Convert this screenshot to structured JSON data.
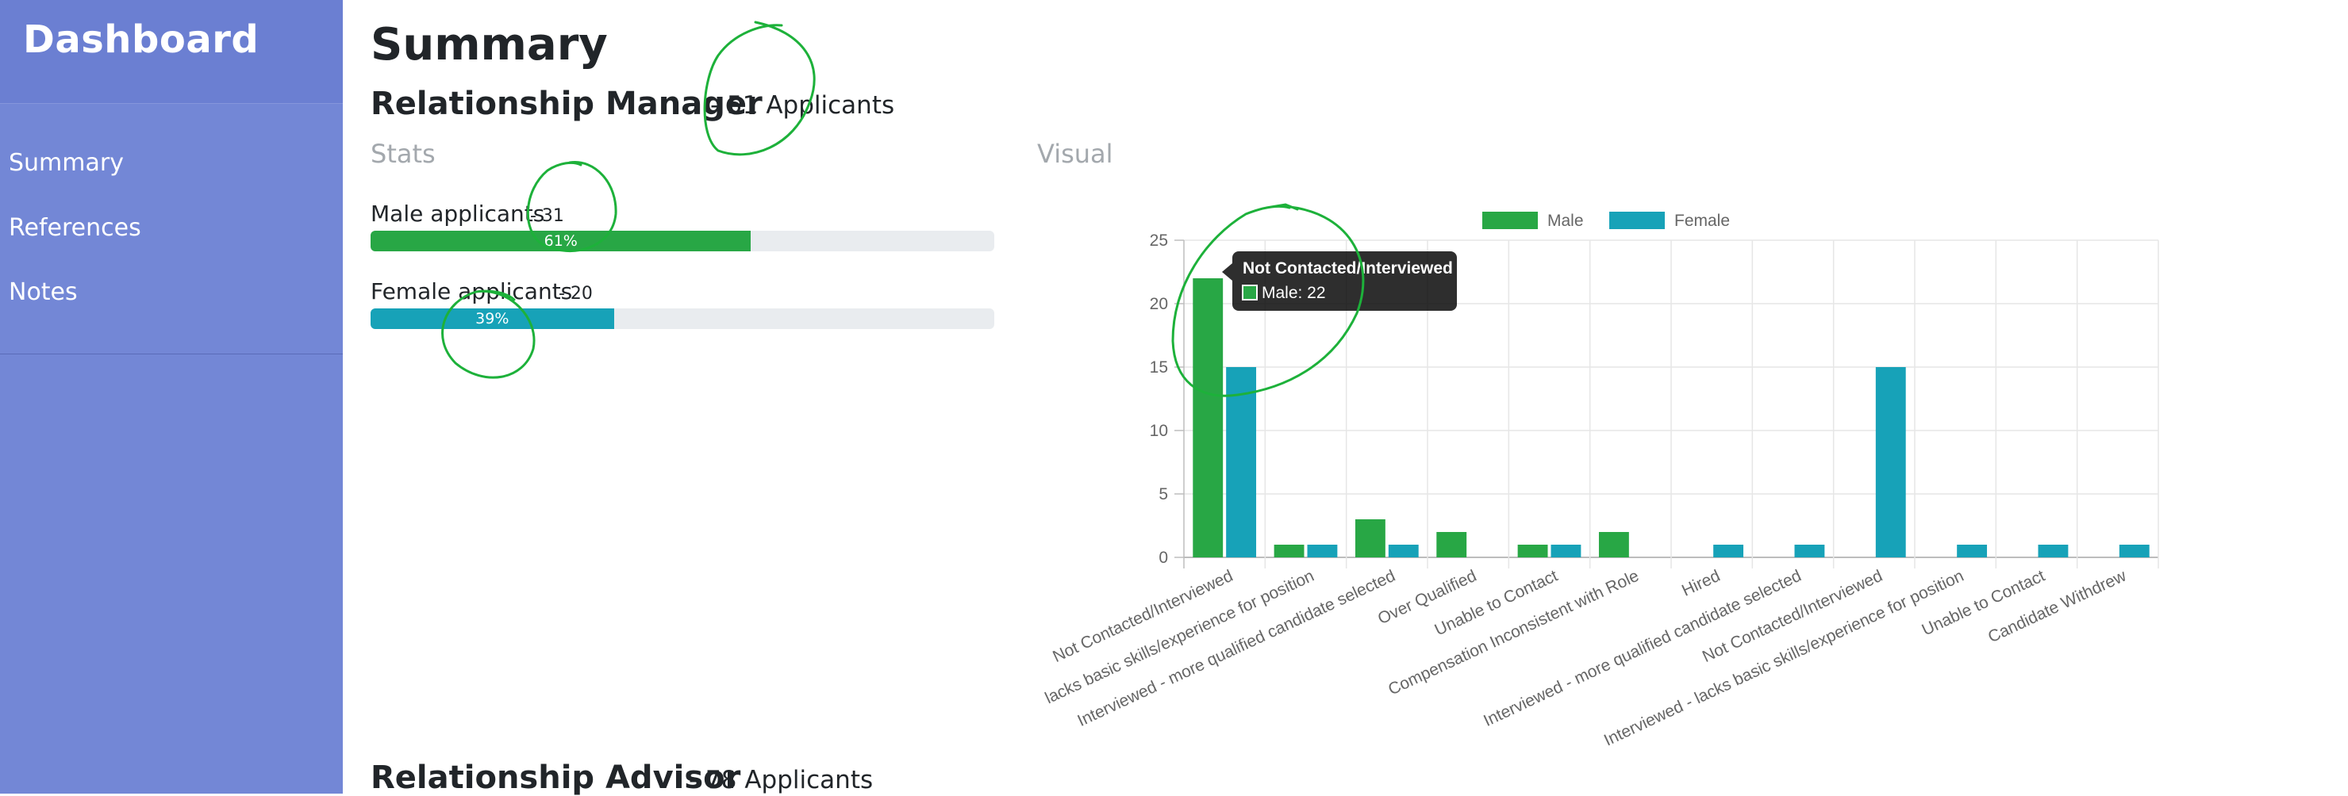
{
  "sidebar": {
    "brand": "Dashboard",
    "items": [
      {
        "label": "Summary"
      },
      {
        "label": "References"
      },
      {
        "label": "Notes"
      }
    ]
  },
  "page": {
    "title": "Summary"
  },
  "sections": [
    {
      "title": "Relationship Manager",
      "applicants": "- 51 Applicants",
      "stats_heading": "Stats",
      "visual_heading": "Visual",
      "stats": [
        {
          "label": "Male applicants",
          "count": "- 31",
          "percent_label": "61%",
          "percent": 61,
          "color": "#28a745"
        },
        {
          "label": "Female applicants",
          "count": "- 20",
          "percent_label": "39%",
          "percent": 39,
          "color": "#17a2b8"
        }
      ]
    },
    {
      "title": "Relationship Advisor",
      "applicants": "- 78 Applicants"
    }
  ],
  "tooltip": {
    "title": "Not Contacted/Interviewed",
    "body": "Male: 22"
  },
  "colors": {
    "male": "#28a745",
    "female": "#17a2b8",
    "sidebar": "#7387d6",
    "annotation": "#1db13a"
  },
  "chart_data": {
    "type": "bar",
    "legend_position": "top",
    "grid": true,
    "ylim": [
      0,
      25
    ],
    "yticks": [
      0,
      5,
      10,
      15,
      20,
      25
    ],
    "categories": [
      "Not Contacted/Interviewed",
      "lacks basic skills/experience for position",
      "Interviewed - more qualified candidate selected",
      "Over Qualified",
      "Unable to Contact",
      "Compensation Inconsistent with Role",
      "Hired",
      "Interviewed - more qualified candidate selected",
      "Not Contacted/Interviewed",
      "Interviewed - lacks basic skills/experience for position",
      "Unable to Contact",
      "Candidate Withdrew"
    ],
    "series": [
      {
        "name": "Male",
        "color": "#28a745",
        "values": [
          22,
          1,
          3,
          2,
          1,
          2,
          0,
          0,
          0,
          0,
          0,
          0
        ]
      },
      {
        "name": "Female",
        "color": "#17a2b8",
        "values": [
          15,
          1,
          1,
          0,
          1,
          0,
          1,
          1,
          15,
          1,
          1,
          1
        ]
      }
    ]
  }
}
